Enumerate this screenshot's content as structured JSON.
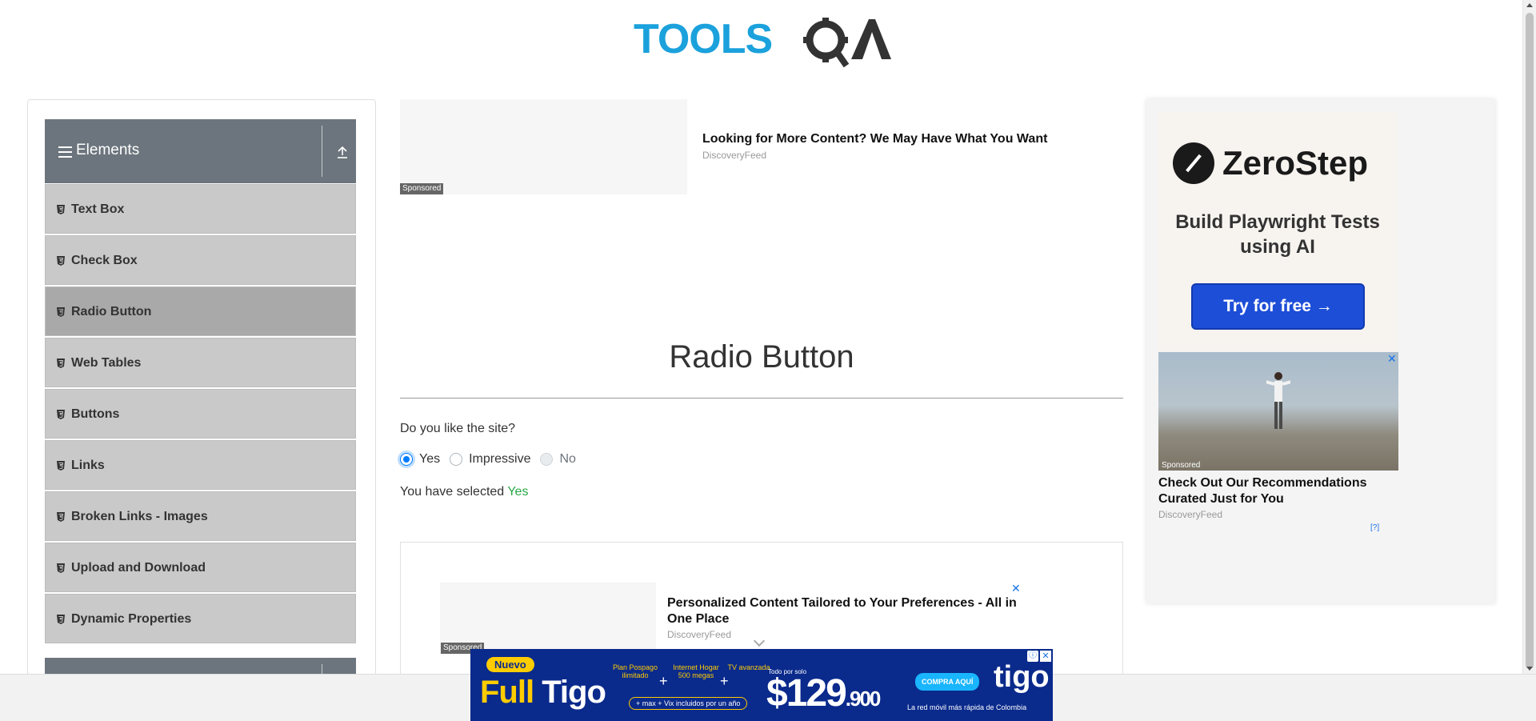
{
  "header": {
    "logo_text": "TOOLSQA"
  },
  "sidebar": {
    "group_title": "Elements",
    "items": [
      {
        "label": "Text Box"
      },
      {
        "label": "Check Box"
      },
      {
        "label": "Radio Button"
      },
      {
        "label": "Web Tables"
      },
      {
        "label": "Buttons"
      },
      {
        "label": "Links"
      },
      {
        "label": "Broken Links - Images"
      },
      {
        "label": "Upload and Download"
      },
      {
        "label": "Dynamic Properties"
      }
    ],
    "active_item": "Radio Button"
  },
  "ad_top": {
    "sponsored": "Sponsored",
    "title": "Looking for More Content? We May Have What You Want",
    "source": "DiscoveryFeed"
  },
  "main": {
    "title": "Radio Button",
    "question": "Do you like the site?",
    "options": [
      {
        "label": "Yes",
        "checked": true,
        "disabled": false
      },
      {
        "label": "Impressive",
        "checked": false,
        "disabled": false
      },
      {
        "label": "No",
        "checked": false,
        "disabled": true
      }
    ],
    "result_prefix": "You have selected ",
    "result_value": "Yes"
  },
  "ad_bottom": {
    "sponsored": "Sponsored",
    "title": "Personalized Content Tailored to Your Preferences - All in One Place",
    "source": "DiscoveryFeed"
  },
  "ad_right": {
    "brand": "ZeroStep",
    "tagline": "Build Playwright Tests using AI",
    "cta": "Try for free →",
    "sponsored": "Sponsored",
    "title": "Check Out Our Recommendations Curated Just for You",
    "source": "DiscoveryFeed",
    "info": "[?]"
  },
  "ad_tigo": {
    "badge": "Nuevo",
    "brand_a": "Full ",
    "brand_b": "Tigo",
    "feat1": "Plan Pospago ilimitado",
    "feat2": "Internet Hogar 500 megas",
    "feat3": "TV avanzada",
    "included": "+ max + Vix incluidos por un año",
    "price_pre": "Todo por solo",
    "price": "$129",
    "price_small": ".900",
    "cta": "COMPRA AQUÍ",
    "logo": "tigo",
    "slogan": "La red móvil más rápida de Colombia"
  },
  "colors": {
    "sidebar_header": "#6c757d",
    "menu_item": "#c9c9c9",
    "menu_item_active": "#a9a9a9",
    "radio_accent": "#007bff",
    "success": "#28a745",
    "logo_blue": "#1ba1dc",
    "logo_dark": "#333333"
  }
}
